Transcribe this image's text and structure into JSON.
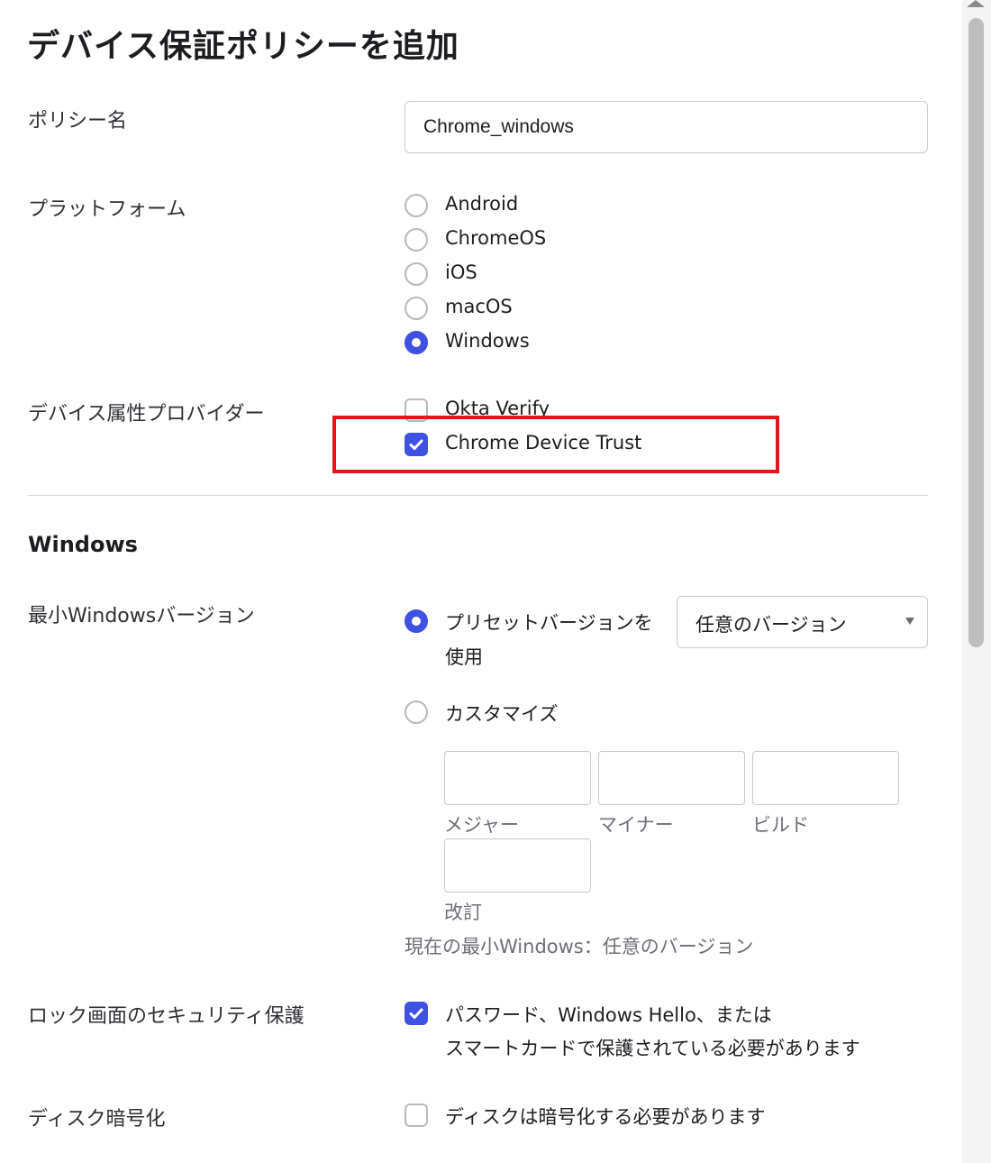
{
  "page": {
    "title": "デバイス保証ポリシーを追加"
  },
  "policy_name": {
    "label": "ポリシー名",
    "value": "Chrome_windows"
  },
  "platform": {
    "label": "プラットフォーム",
    "options": [
      {
        "label": "Android",
        "selected": false
      },
      {
        "label": "ChromeOS",
        "selected": false
      },
      {
        "label": "iOS",
        "selected": false
      },
      {
        "label": "macOS",
        "selected": false
      },
      {
        "label": "Windows",
        "selected": true
      }
    ]
  },
  "provider": {
    "label": "デバイス属性プロバイダー",
    "options": [
      {
        "label": "Okta Verify",
        "checked": false
      },
      {
        "label": "Chrome Device Trust",
        "checked": true
      }
    ]
  },
  "windows_section": {
    "title": "Windows",
    "min_version": {
      "label": "最小Windowsバージョン",
      "preset_label_line1": "プリセットバージョンを",
      "preset_label_line2": "使用",
      "preset_selected": true,
      "preset_select_value": "任意のバージョン",
      "custom_label": "カスタマイズ",
      "custom_selected": false,
      "fields": {
        "major": "メジャー",
        "minor": "マイナー",
        "build": "ビルド",
        "revision": "改訂"
      },
      "current_text": "現在の最小Windows：任意のバージョン"
    },
    "lock_screen": {
      "label": "ロック画面のセキュリティ保護",
      "checked": true,
      "option_line1": "パスワード、Windows Hello、または",
      "option_line2": "スマートカードで保護されている必要があります"
    },
    "disk_encryption": {
      "label": "ディスク暗号化",
      "checked": false,
      "option": "ディスクは暗号化する必要があります"
    }
  },
  "colors": {
    "accent": "#3f51e0",
    "highlight": "#e8141c"
  }
}
